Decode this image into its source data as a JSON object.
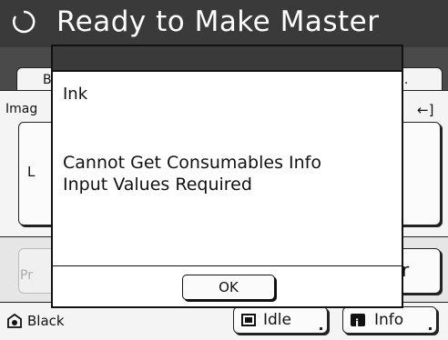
{
  "header": {
    "title": "Ready to Make Master",
    "status_icon": "status-circle-icon"
  },
  "tabs": {
    "left_label": "B",
    "right_label": "n."
  },
  "content": {
    "image_label": "Imag",
    "corner_arrow": "←]",
    "left_box_label": "L"
  },
  "bottom": {
    "left_button_label": "Pr",
    "right_button_label": "r"
  },
  "footer": {
    "ink_label": "Black",
    "idle_label": "Idle",
    "info_label": "Info"
  },
  "dialog": {
    "heading": "Ink",
    "message_line1": "Cannot Get Consumables Info",
    "message_line2": "Input Values Required",
    "ok_label": "OK"
  },
  "colors": {
    "header_bg": "#3a3a3a",
    "panel_bg": "#4a4a4a",
    "dialog_bg": "#ffffff"
  }
}
